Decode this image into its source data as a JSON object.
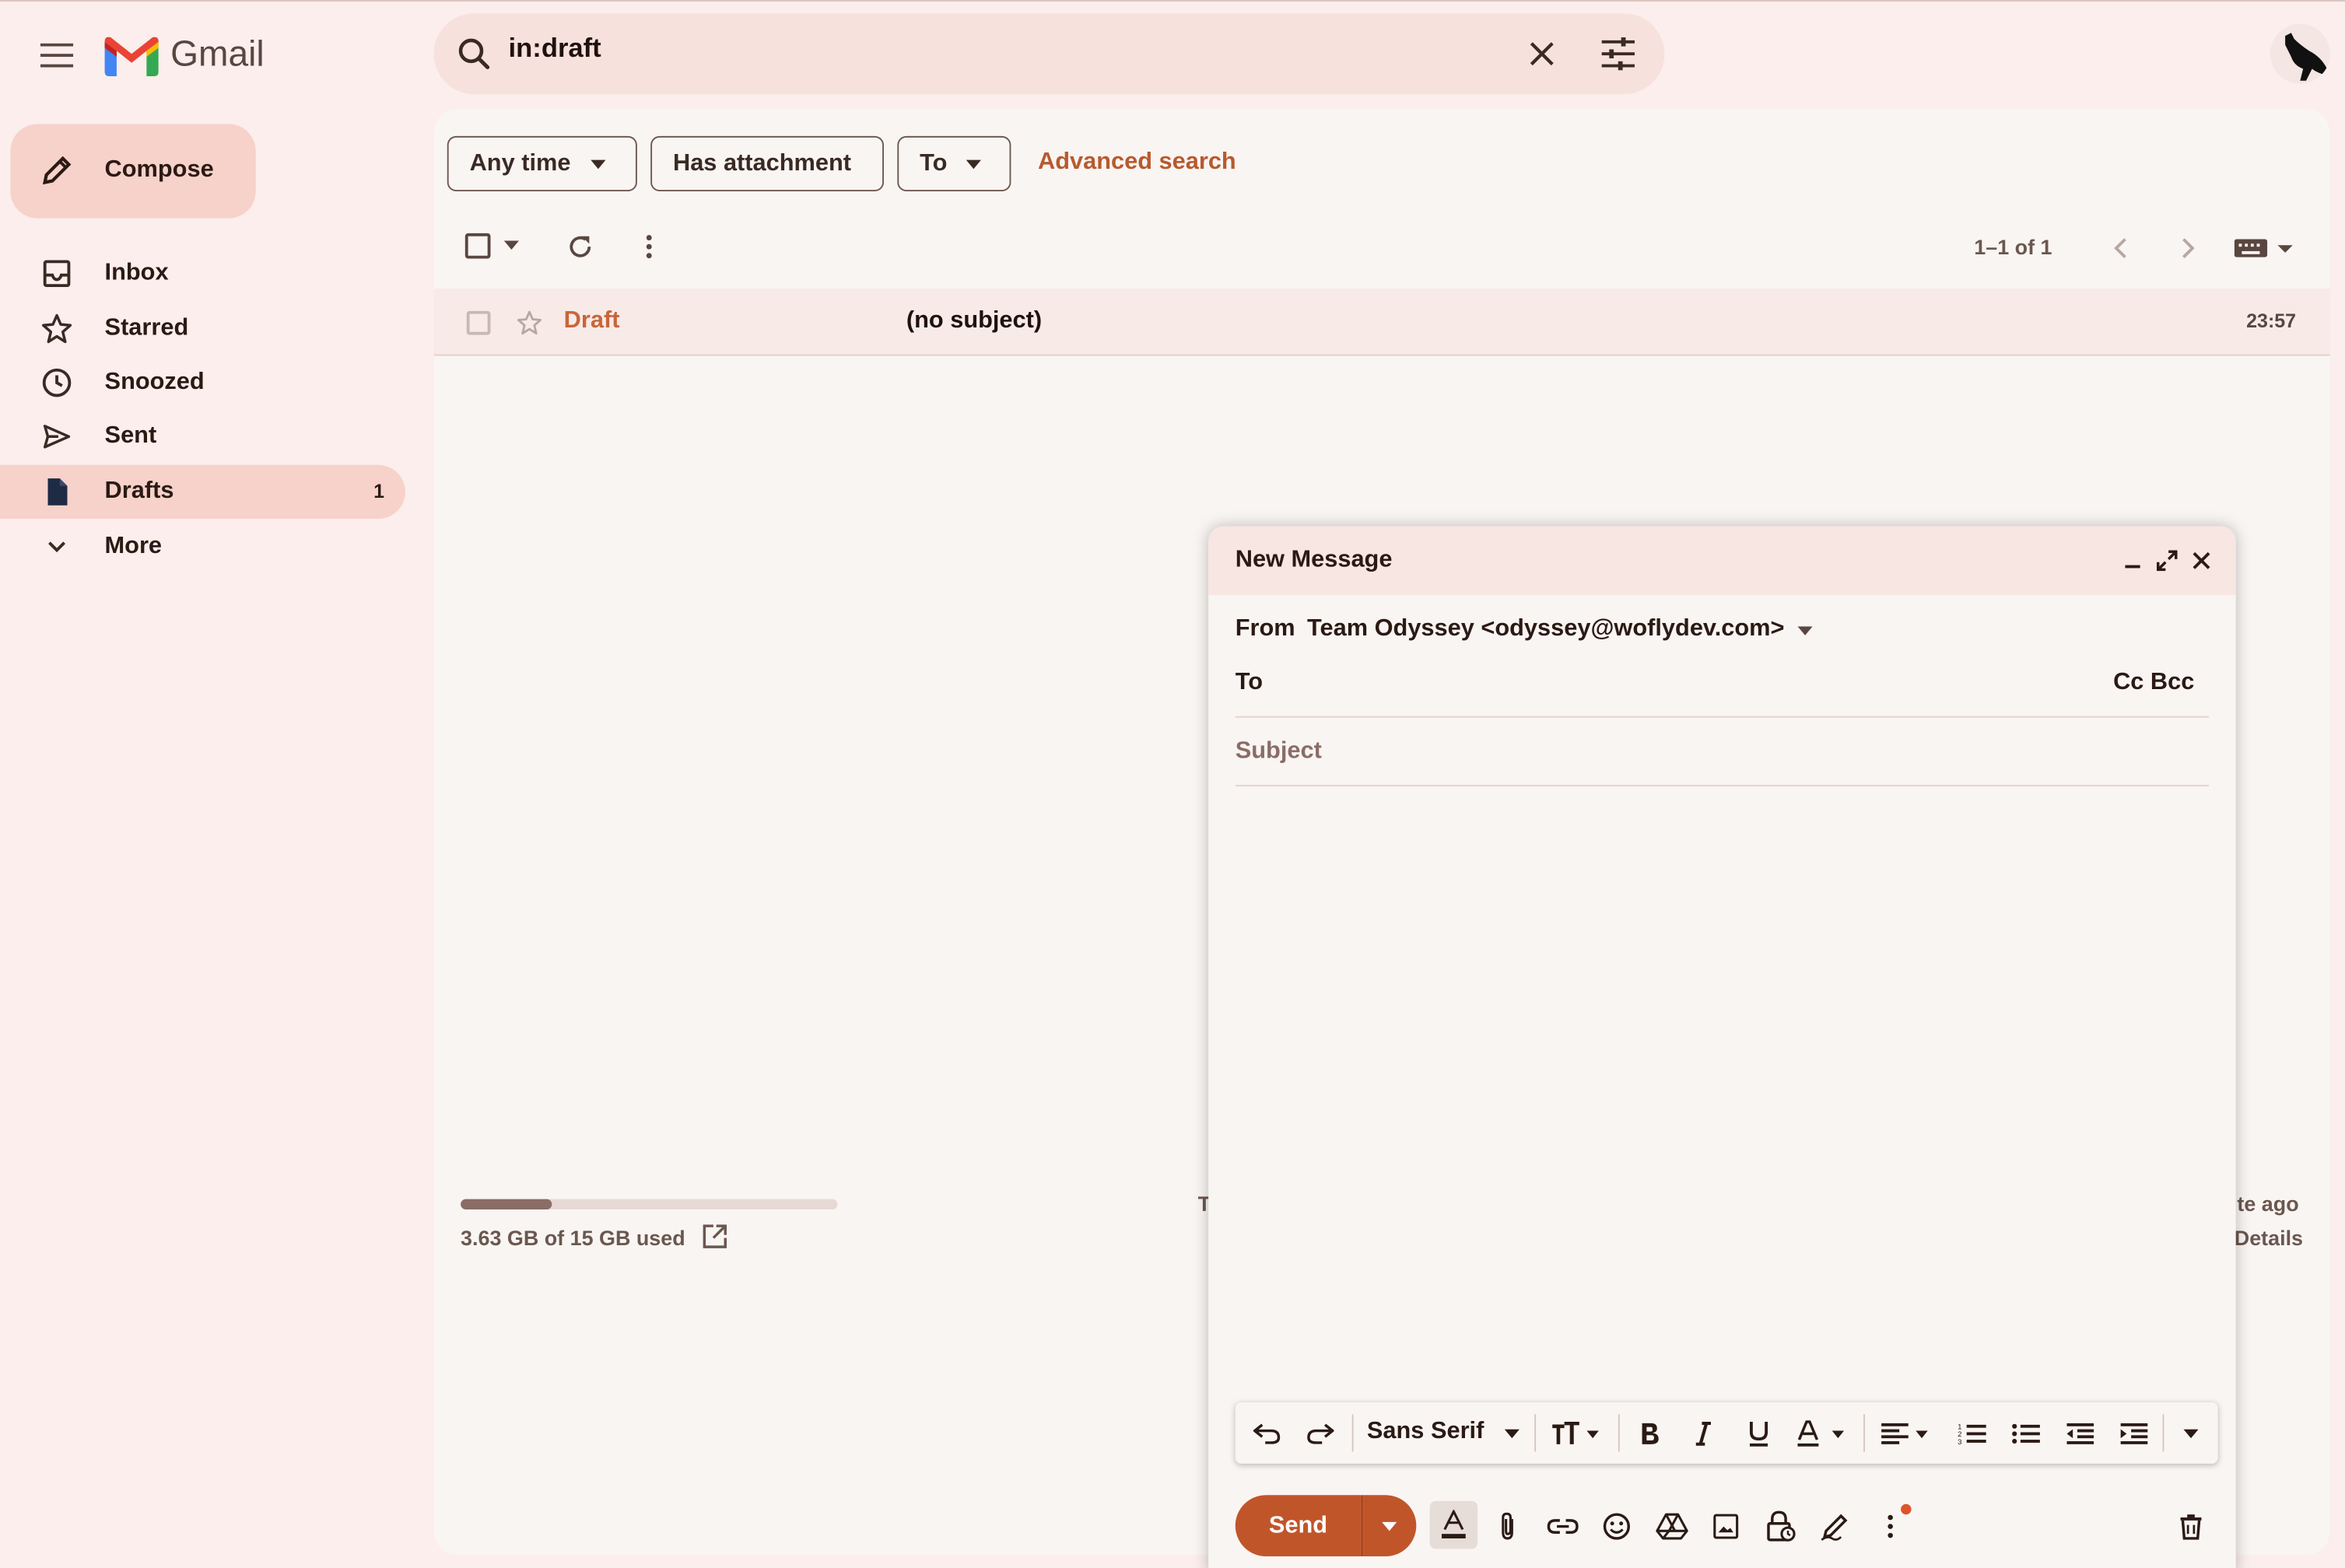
{
  "app": {
    "name": "Gmail"
  },
  "search": {
    "query": "in:draft"
  },
  "sidebar": {
    "compose_label": "Compose",
    "items": [
      {
        "label": "Inbox",
        "icon": "inbox-icon",
        "count": ""
      },
      {
        "label": "Starred",
        "icon": "star-icon",
        "count": ""
      },
      {
        "label": "Snoozed",
        "icon": "clock-icon",
        "count": ""
      },
      {
        "label": "Sent",
        "icon": "send-icon",
        "count": ""
      },
      {
        "label": "Drafts",
        "icon": "draft-icon",
        "count": "1",
        "active": true
      },
      {
        "label": "More",
        "icon": "chevron-down-icon",
        "count": ""
      }
    ]
  },
  "filters": {
    "any_time": "Any time",
    "has_attachment": "Has attachment",
    "to": "To",
    "advanced_search": "Advanced search"
  },
  "toolbar": {
    "pager": "1–1 of 1"
  },
  "messages": [
    {
      "sender": "Draft",
      "subject": "(no subject)",
      "time": "23:57"
    }
  ],
  "storage": {
    "text": "3.63 GB of 15 GB used",
    "used_fraction": 0.242
  },
  "footer": {
    "terms_fragment": "T",
    "activity_fragment": "ıte ago",
    "details_fragment": "Details"
  },
  "compose": {
    "title": "New Message",
    "from_label": "From",
    "from_value": "Team Odyssey <odyssey@woflydev.com>",
    "to_label": "To",
    "cc_bcc": "Cc Bcc",
    "subject_placeholder": "Subject",
    "font_name": "Sans Serif",
    "send_label": "Send"
  },
  "colors": {
    "background": "#fbeeec",
    "panel": "#f9f5f3",
    "accent": "#c1552a",
    "link": "#b75a2e",
    "active_nav": "#f7d2ca"
  }
}
